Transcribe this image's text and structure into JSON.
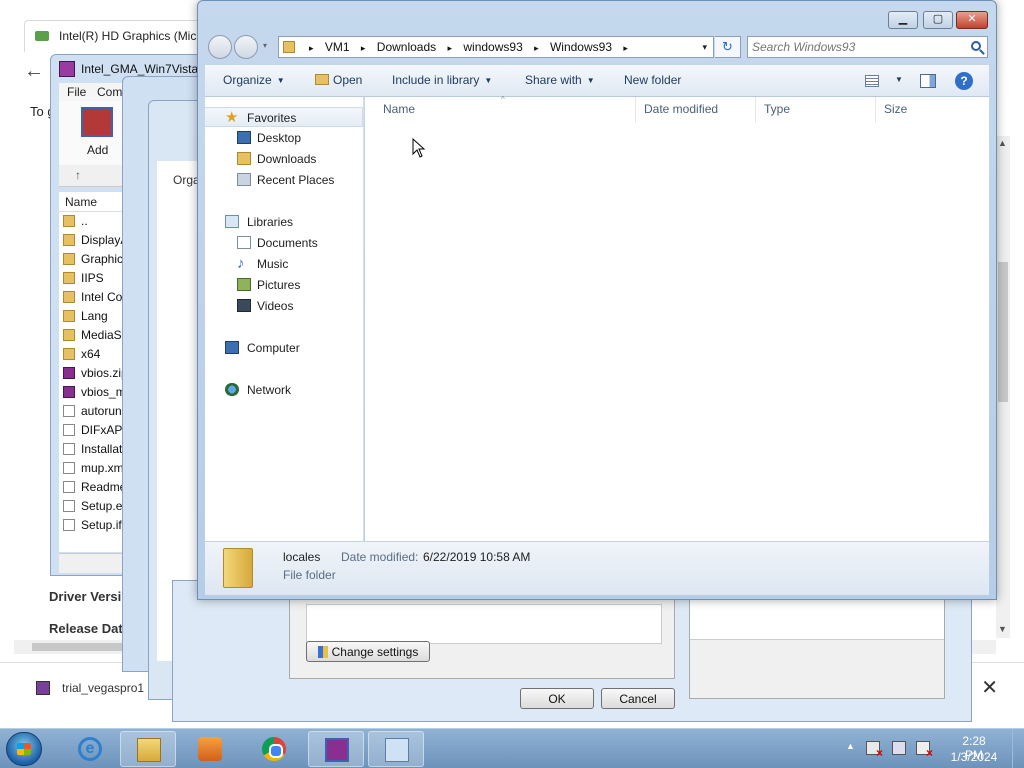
{
  "browser": {
    "tab_title": "Intel(R) HD Graphics (Micr",
    "page_text": "To g",
    "driver_version_label": "Driver Versi",
    "release_date_label": "Release Dat",
    "download_item": "trial_vegaspro1",
    "back_glyph": "←",
    "close_glyph": "✕"
  },
  "winrar": {
    "title": "Intel_GMA_Win7Vista",
    "menu": [
      "File",
      "Com"
    ],
    "add_label": "Add",
    "column_name": "Name",
    "rows": [
      {
        "name": "..",
        "type": "folder"
      },
      {
        "name": "DisplayA",
        "type": "folder"
      },
      {
        "name": "Graphic",
        "type": "folder"
      },
      {
        "name": "IIPS",
        "type": "folder"
      },
      {
        "name": "Intel Co",
        "type": "folder"
      },
      {
        "name": "Lang",
        "type": "folder"
      },
      {
        "name": "MediaSD",
        "type": "folder"
      },
      {
        "name": "x64",
        "type": "folder"
      },
      {
        "name": "vbios.zip",
        "type": "rar"
      },
      {
        "name": "vbios_m",
        "type": "rar"
      },
      {
        "name": "autorun",
        "type": "file"
      },
      {
        "name": "DIFxAPI",
        "type": "file"
      },
      {
        "name": "Installat",
        "type": "file"
      },
      {
        "name": "mup.xm",
        "type": "file"
      },
      {
        "name": "Readme",
        "type": "file"
      },
      {
        "name": "Setup.ex",
        "type": "file"
      },
      {
        "name": "Setup.if",
        "type": "file"
      }
    ]
  },
  "stack": {
    "organize_label": "Orga",
    "change_settings": "Change settings",
    "ok": "OK",
    "cancel": "Cancel"
  },
  "dialog": {
    "caption": {
      "minimize": "▁",
      "maximize": "▢",
      "close": "✕"
    },
    "nav": {
      "back": "◀",
      "forward": "▶",
      "dropdown": "▾"
    },
    "address": {
      "crumbs": [
        "VM1",
        "Downloads",
        "windows93",
        "Windows93"
      ],
      "separator": "▸",
      "dropdown": "▾"
    },
    "refresh_glyph": "↻",
    "search": {
      "placeholder": "Search Windows93",
      "value": ""
    },
    "commands": {
      "organize": "Organize",
      "open": "Open",
      "include_in_library": "Include in library",
      "share_with": "Share with",
      "new_folder": "New folder",
      "caret": "▼",
      "help": "?"
    },
    "nav_pane": {
      "favorites": "Favorites",
      "desktop": "Desktop",
      "downloads": "Downloads",
      "recent_places": "Recent Places",
      "libraries": "Libraries",
      "documents": "Documents",
      "music": "Music",
      "pictures": "Pictures",
      "videos": "Videos",
      "computer": "Computer",
      "network": "Network"
    },
    "columns": {
      "name": "Name",
      "date_modified": "Date modified",
      "type": "Type",
      "size": "Size",
      "sort_arrow": "^"
    },
    "details": {
      "name": "locales",
      "date_label": "Date modified:",
      "date_value": "6/22/2019 10:58 AM",
      "type": "File folder"
    }
  },
  "taskbar": {
    "clock_time": "2:28 PM",
    "clock_date": "1/3/2024",
    "ie_glyph": "e",
    "tray_up": "▲"
  },
  "colors": {
    "dialog_frame": "#b6cde7",
    "taskbar": "#6e93bb",
    "command_text": "#1e395b"
  }
}
